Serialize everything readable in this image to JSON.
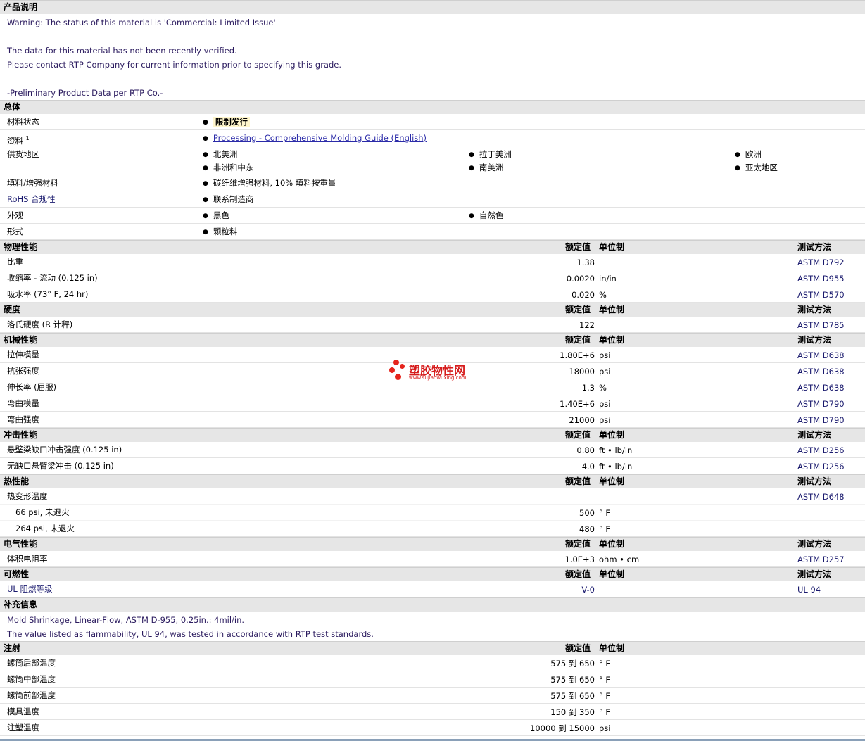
{
  "description": {
    "title": "产品说明",
    "lines": [
      "Warning: The status of this material is 'Commercial: Limited Issue'",
      "",
      "The data for this material has not been recently verified.",
      "Please contact RTP Company for current information prior to specifying this grade.",
      "",
      "-Preliminary Product Data per RTP Co.-"
    ]
  },
  "general": {
    "title": "总体",
    "status_label": "材料状态",
    "status_value": "限制发行",
    "docs_label": "资料",
    "docs_sup": "1",
    "docs_link": "Processing - Comprehensive Molding Guide (English)",
    "regions_label": "供货地区",
    "regions": [
      "北美洲",
      "拉丁美洲",
      "欧洲",
      "非洲和中东",
      "南美洲",
      "亚太地区"
    ],
    "filler_label": "填料/增强材料",
    "filler_value": "碳纤维增强材料, 10% 填料按重量",
    "rohs_label": "RoHS 合规性",
    "rohs_value": "联系制造商",
    "appearance_label": "外观",
    "appearance_values": [
      "黑色",
      "自然色"
    ],
    "form_label": "形式",
    "form_value": "颗粒料"
  },
  "headers": {
    "value": "额定值",
    "unit": "单位制",
    "method": "测试方法"
  },
  "physical": {
    "title": "物理性能",
    "rows": [
      {
        "label": "比重",
        "value": "1.38",
        "unit": "",
        "method": "ASTM D792"
      },
      {
        "label": "收缩率  - 流动  (0.125 in)",
        "value": "0.0020",
        "unit": "in/in",
        "method": "ASTM D955"
      },
      {
        "label": "吸水率  (73° F, 24 hr)",
        "value": "0.020",
        "unit": "%",
        "method": "ASTM D570"
      }
    ]
  },
  "hardness": {
    "title": "硬度",
    "rows": [
      {
        "label": "洛氏硬度  (R 计秤)",
        "value": "122",
        "unit": "",
        "method": "ASTM D785"
      }
    ]
  },
  "mechanical": {
    "title": "机械性能",
    "rows": [
      {
        "label": "拉伸模量",
        "value": "1.80E+6",
        "unit": "psi",
        "method": "ASTM D638"
      },
      {
        "label": "抗张强度",
        "value": "18000",
        "unit": "psi",
        "method": "ASTM D638"
      },
      {
        "label": "伸长率  (屈服)",
        "value": "1.3",
        "unit": "%",
        "method": "ASTM D638"
      },
      {
        "label": "弯曲模量",
        "value": "1.40E+6",
        "unit": "psi",
        "method": "ASTM D790"
      },
      {
        "label": "弯曲强度",
        "value": "21000",
        "unit": "psi",
        "method": "ASTM D790"
      }
    ]
  },
  "impact": {
    "title": "冲击性能",
    "rows": [
      {
        "label": "悬壁梁缺口冲击强度  (0.125 in)",
        "value": "0.80",
        "unit": "ft • lb/in",
        "method": "ASTM D256"
      },
      {
        "label": "无缺口悬臂梁冲击  (0.125 in)",
        "value": "4.0",
        "unit": "ft • lb/in",
        "method": "ASTM D256"
      }
    ]
  },
  "thermal": {
    "title": "热性能",
    "main_label": "热变形温度",
    "main_method": "ASTM D648",
    "rows": [
      {
        "label": "66 psi, 未退火",
        "value": "500",
        "unit": "° F"
      },
      {
        "label": "264 psi, 未退火",
        "value": "480",
        "unit": "° F"
      }
    ]
  },
  "electrical": {
    "title": "电气性能",
    "rows": [
      {
        "label": "体积电阻率",
        "value": "1.0E+3",
        "unit": "ohm • cm",
        "method": "ASTM D257"
      }
    ]
  },
  "flammability": {
    "title": "可燃性",
    "rows": [
      {
        "label": "UL 阻燃等级",
        "value": "V-0",
        "unit": "",
        "method": "UL 94"
      }
    ]
  },
  "supplement": {
    "title": "补充信息",
    "lines": [
      "Mold Shrinkage, Linear-Flow, ASTM D-955, 0.25in.: 4mil/in.",
      "The value listed as flammability, UL 94, was tested in accordance with RTP test standards."
    ]
  },
  "injection": {
    "title": "注射",
    "rows": [
      {
        "label": "螺筒后部温度",
        "value": "575 到  650",
        "unit": "° F"
      },
      {
        "label": "螺筒中部温度",
        "value": "575 到  650",
        "unit": "° F"
      },
      {
        "label": "螺筒前部温度",
        "value": "575 到  650",
        "unit": "° F"
      },
      {
        "label": "模具温度",
        "value": "150 到  350",
        "unit": "° F"
      },
      {
        "label": "注塑温度",
        "value": "10000 到  15000",
        "unit": "psi"
      }
    ]
  },
  "watermark": {
    "text": "塑胶物性网",
    "url": "www.sujiaowuxing.com"
  }
}
